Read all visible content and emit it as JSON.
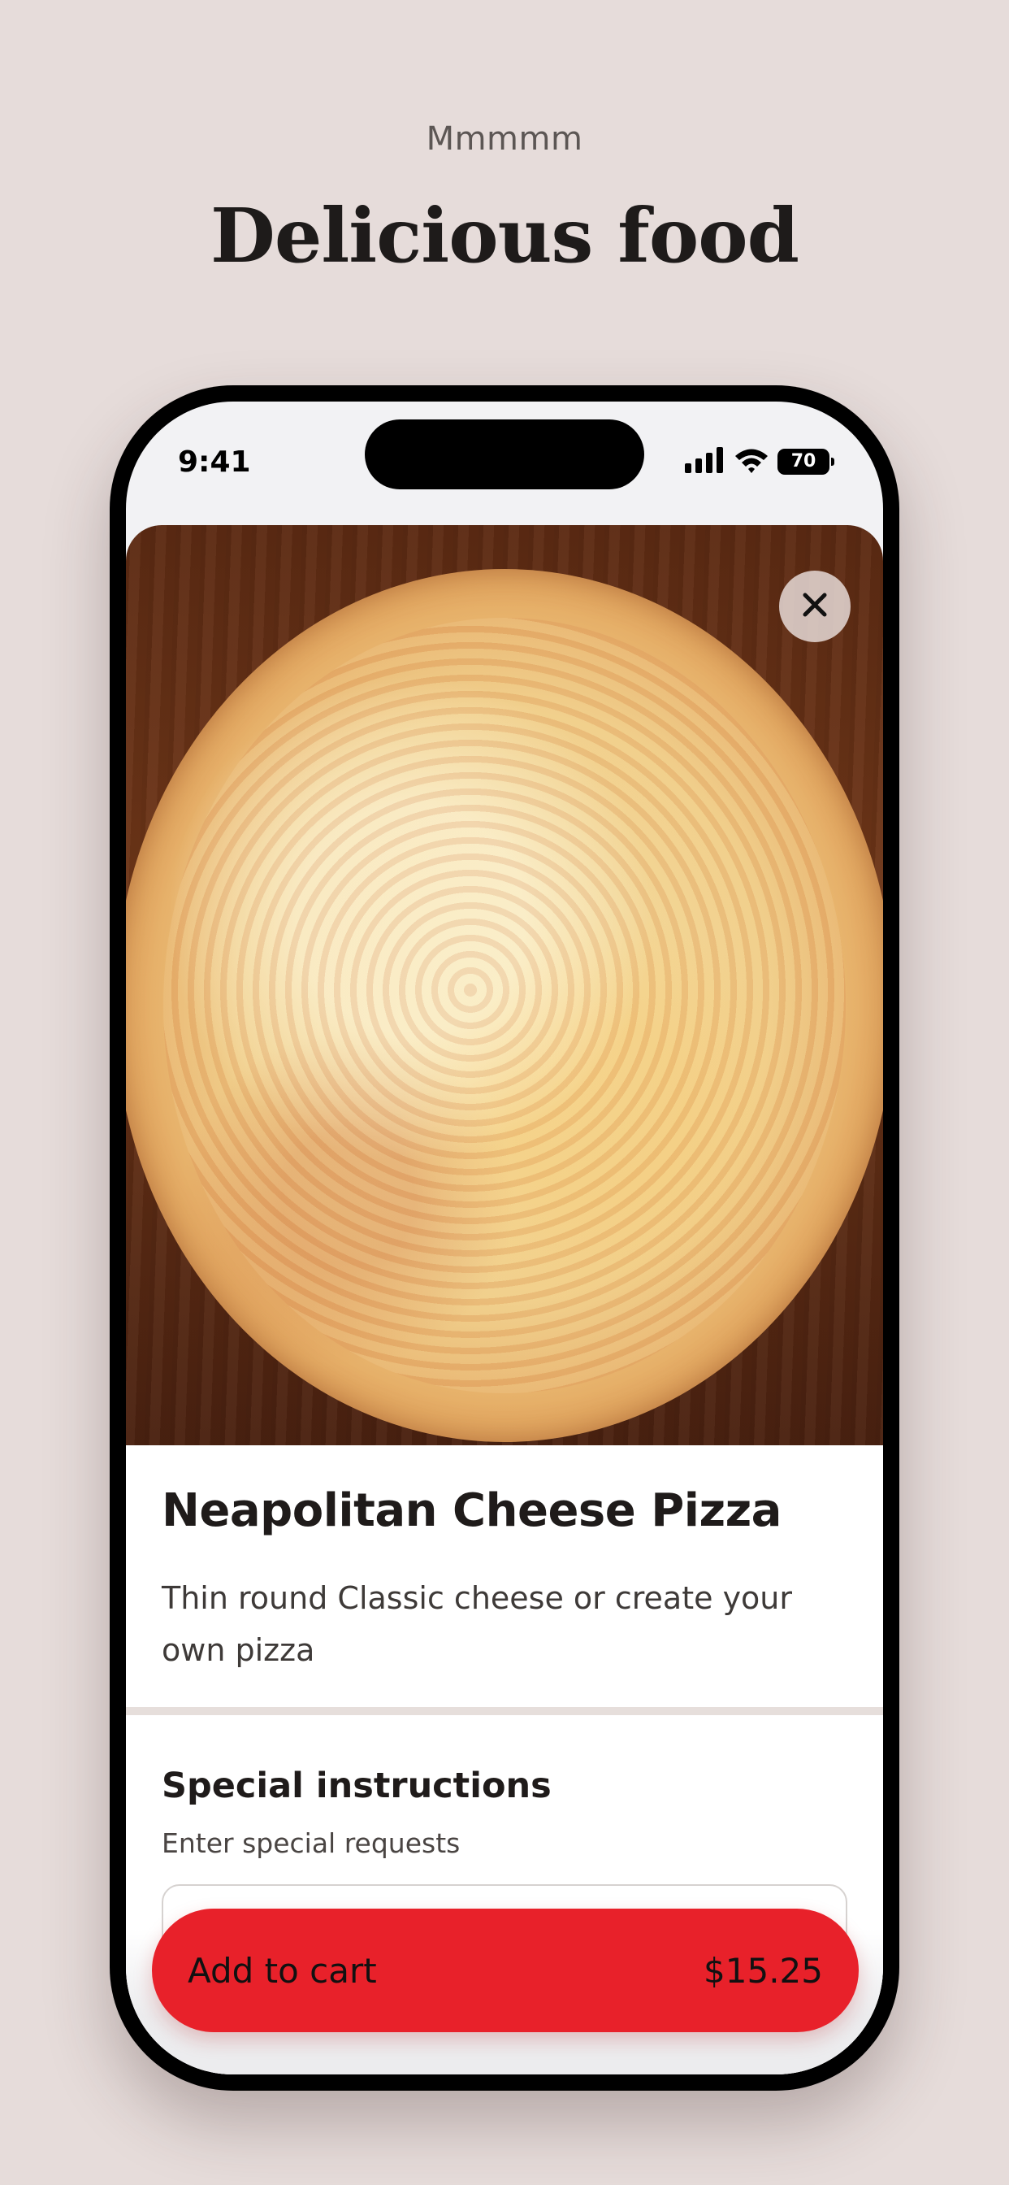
{
  "header": {
    "eyebrow": "Mmmmm",
    "title": "Delicious food"
  },
  "status_bar": {
    "time": "9:41",
    "battery": "70",
    "icons": [
      "cellular-signal-icon",
      "wifi-icon",
      "battery-icon"
    ]
  },
  "item": {
    "image": "cheese-pizza-photo",
    "title": "Neapolitan Cheese Pizza",
    "description": "Thin round Classic cheese or create your own pizza"
  },
  "special_instructions": {
    "title": "Special instructions",
    "hint": "Enter special requests",
    "value": ""
  },
  "cart": {
    "label": "Add to cart",
    "price": "$15.25"
  },
  "colors": {
    "background": "#e6dcda",
    "accent": "#e8212a",
    "text": "#1f1b1a"
  }
}
